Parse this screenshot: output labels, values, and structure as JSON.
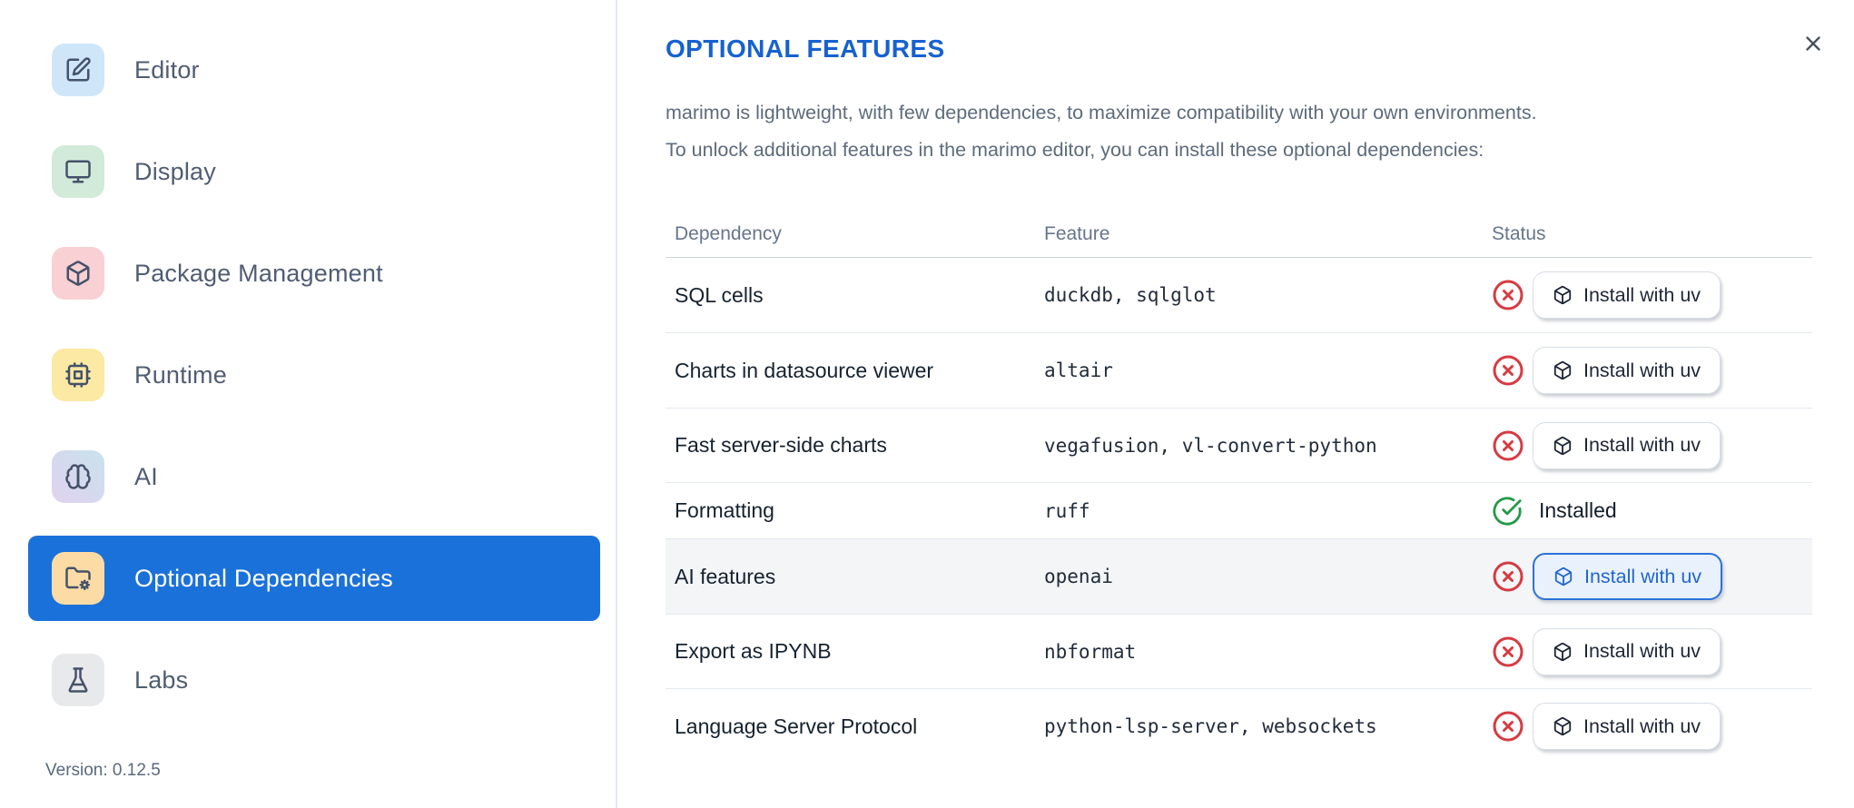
{
  "sidebar": {
    "items": [
      {
        "label": "Editor",
        "icon": "square-pen-icon",
        "icon_style": "background:#cfe6f9"
      },
      {
        "label": "Display",
        "icon": "monitor-icon",
        "icon_style": "background:#d2ead9"
      },
      {
        "label": "Package Management",
        "icon": "package-icon",
        "icon_style": "background:#f9d0d4"
      },
      {
        "label": "Runtime",
        "icon": "cpu-icon",
        "icon_style": "background:#fbe9a4"
      },
      {
        "label": "AI",
        "icon": "brain-icon",
        "icon_style": "background:linear-gradient(45deg,#e2d2ee 0%,#d7d8ef 40%,#c8e3ea 100%)"
      },
      {
        "label": "Optional Dependencies",
        "icon": "folder-cog-icon",
        "icon_style": "background:#fcdcа4",
        "selected": true
      },
      {
        "label": "Labs",
        "icon": "flask-icon",
        "icon_style": "background:#e8e9eb"
      }
    ],
    "selected_item": "Optional Dependencies",
    "version": "Version: 0.12.5"
  },
  "dialog": {
    "title": "OPTIONAL FEATURES",
    "description": "marimo is lightweight, with few dependencies, to maximize compatibility with your own environments.\nTo unlock additional features in the marimo editor, you can install these optional dependencies:",
    "close_icon": "x-icon"
  },
  "table": {
    "headers": [
      "Dependency",
      "Feature",
      "Status"
    ],
    "rows": [
      {
        "dependency": "SQL cells",
        "feature": "duckdb, sqlglot",
        "status": "not-installed",
        "action": "Install with uv"
      },
      {
        "dependency": "Charts in datasource viewer",
        "feature": "altair",
        "status": "not-installed",
        "action": "Install with uv"
      },
      {
        "dependency": "Fast server-side charts",
        "feature": "vegafusion, vl-convert-python",
        "status": "not-installed",
        "action": "Install with uv"
      },
      {
        "dependency": "Formatting",
        "feature": "ruff",
        "status": "installed",
        "status_label": "Installed"
      },
      {
        "dependency": "AI features",
        "feature": "openai",
        "status": "not-installed",
        "action": "Install with uv",
        "highlighted": true
      },
      {
        "dependency": "Export as IPYNB",
        "feature": "nbformat",
        "status": "not-installed",
        "action": "Install with uv"
      },
      {
        "dependency": "Language Server Protocol",
        "feature": "python-lsp-server, websockets",
        "status": "not-installed",
        "action": "Install with uv"
      }
    ]
  },
  "colors": {
    "accent_blue": "#1b71da",
    "title_blue": "#1761d0",
    "error_red": "#d63b42",
    "success_green": "#259a48",
    "highlight_button_border": "#2b72d7",
    "highlight_button_bg": "#e9f1fd",
    "row_highlight": "#f3f5f7",
    "sidebar_icon_editor": "#cfe6f9",
    "sidebar_icon_display": "#d2ead9",
    "sidebar_icon_package": "#f9d0d4",
    "sidebar_icon_runtime": "#fbe9a4",
    "sidebar_icon_optional": "#fcdca4",
    "sidebar_icon_labs": "#e8e9eb"
  }
}
